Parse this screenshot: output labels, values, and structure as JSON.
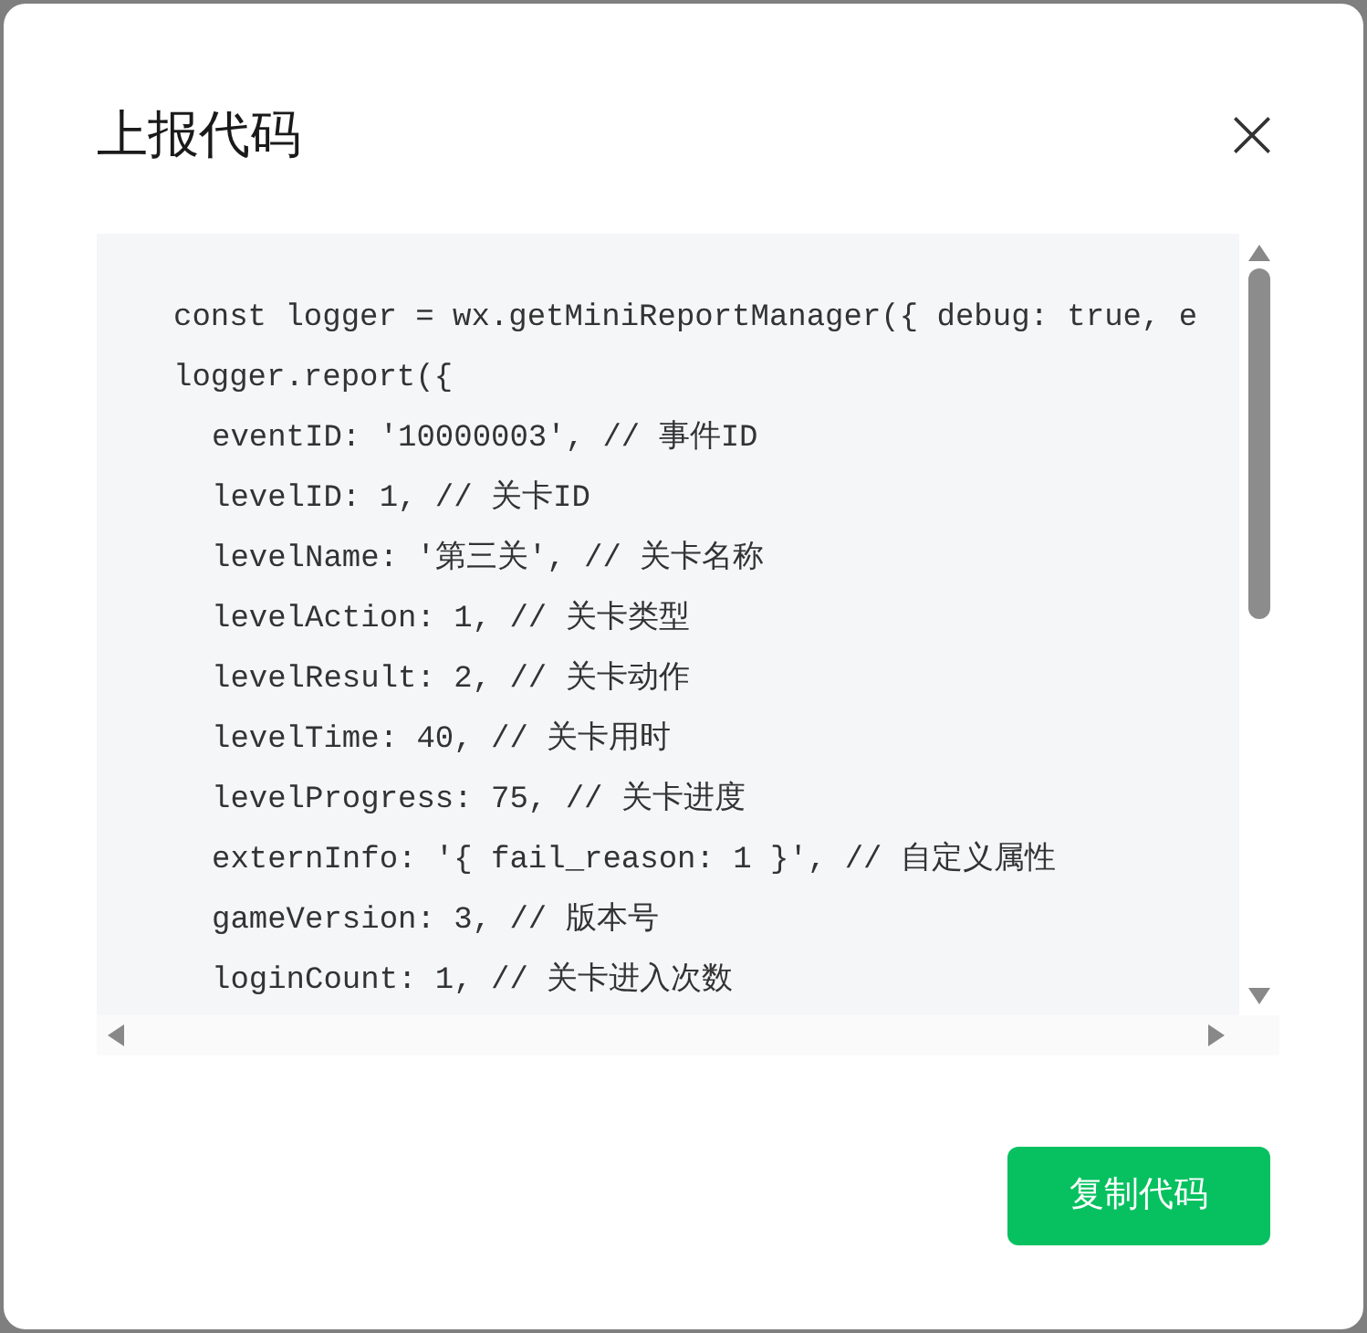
{
  "dialog": {
    "title": "上报代码",
    "code_lines": [
      {
        "text": "const logger = wx.getMiniReportManager({ debug: true, e"
      },
      {
        "text": "logger.report({",
        "children": [
          {
            "text": "eventID: '10000003', // 事件ID"
          },
          {
            "text": "levelID: 1, // 关卡ID"
          },
          {
            "text": "levelName: '第三关', // 关卡名称"
          },
          {
            "text": "levelAction: 1, // 关卡类型"
          },
          {
            "text": "levelResult: 2, // 关卡动作"
          },
          {
            "text": "levelTime: 40, // 关卡用时"
          },
          {
            "text": "levelProgress: 75, // 关卡进度"
          },
          {
            "text": "externInfo: '{ fail_reason: 1 }', // 自定义属性"
          },
          {
            "text": "gameVersion: 3, // 版本号"
          },
          {
            "text": "loginCount: 1, // 关卡进入次数"
          }
        ]
      }
    ],
    "button": "复制代码"
  }
}
